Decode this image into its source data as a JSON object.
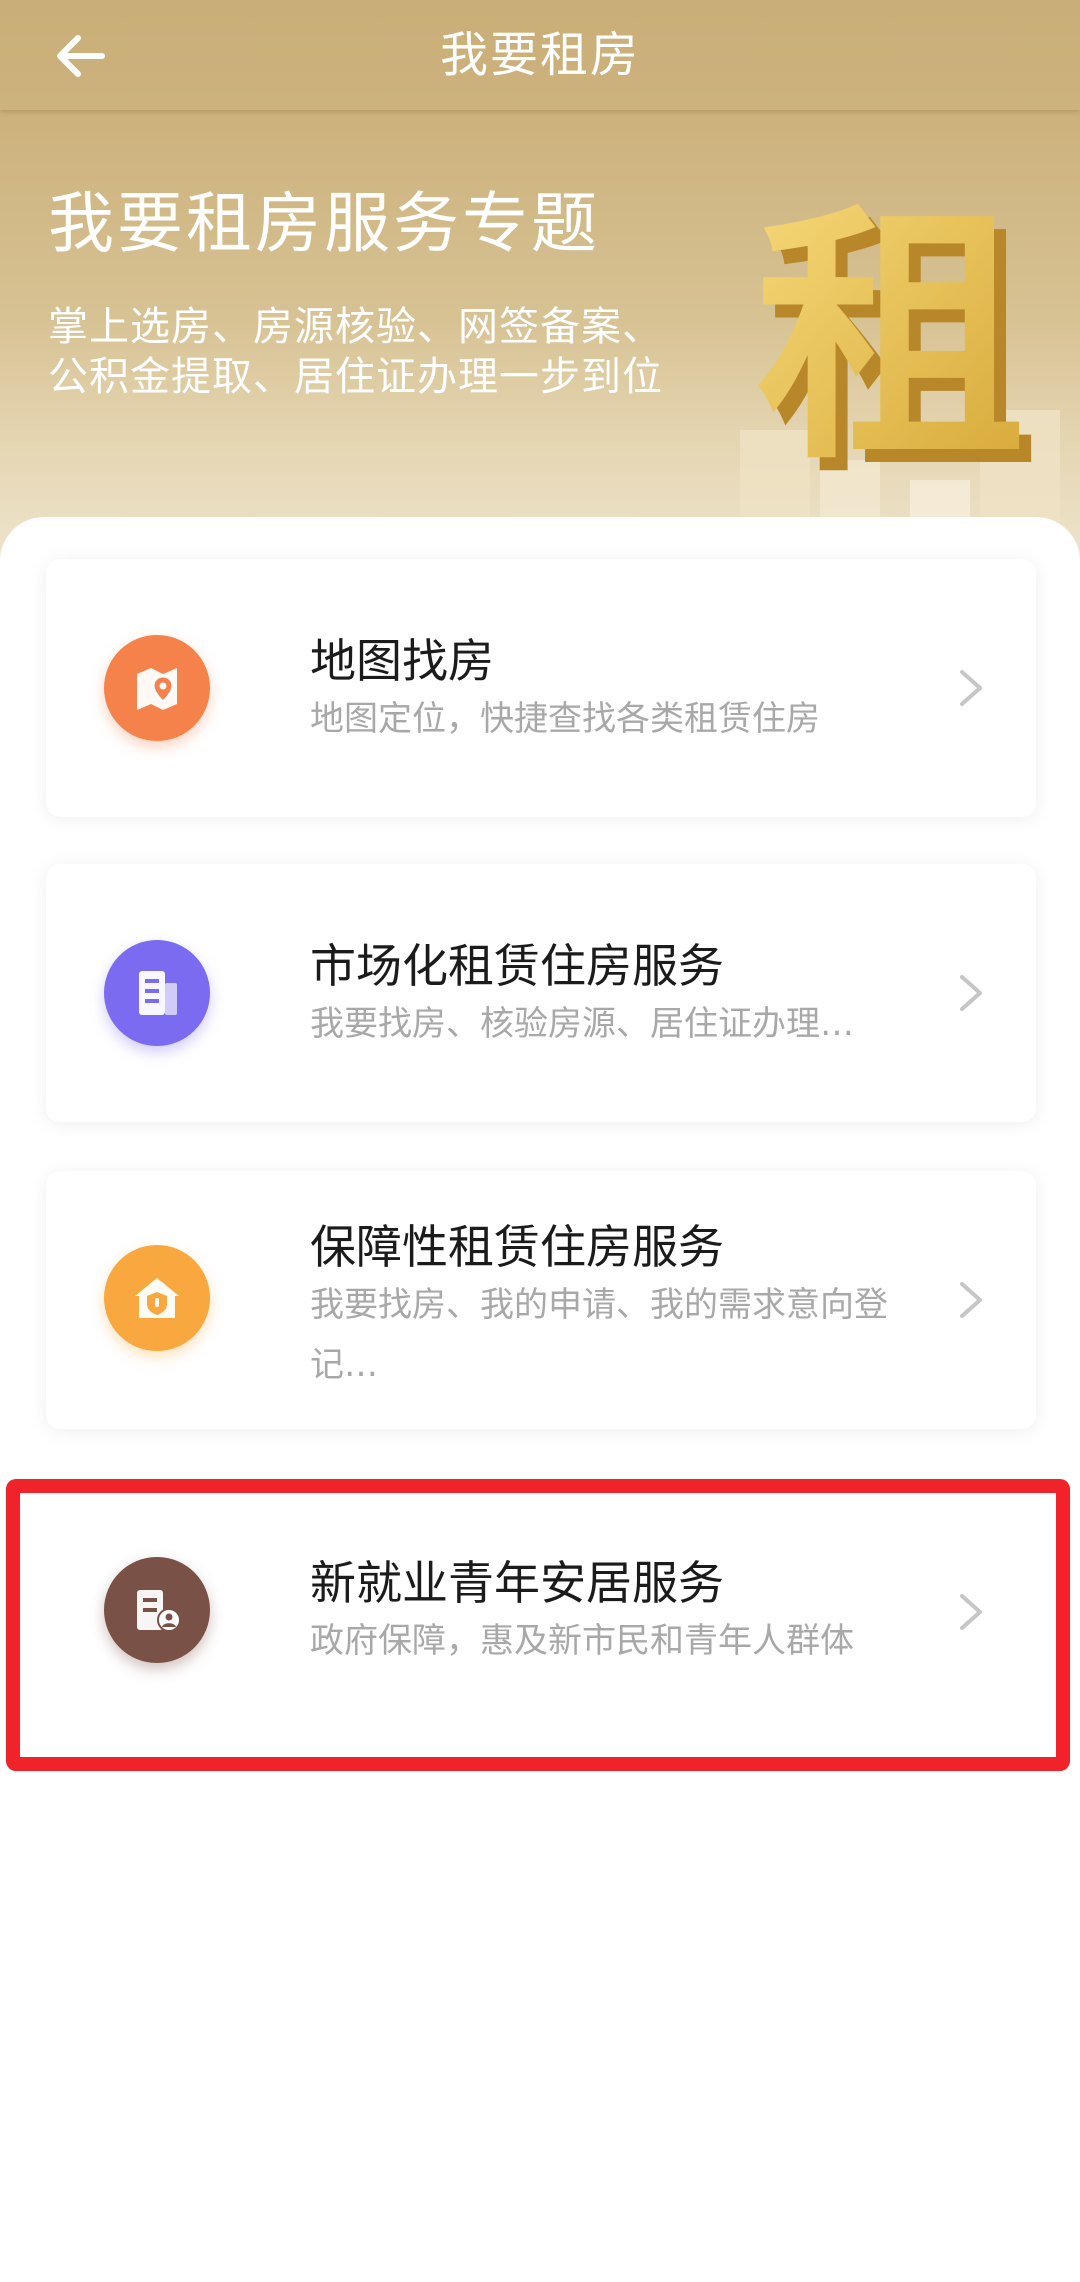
{
  "header": {
    "title": "我要租房",
    "back_icon": "arrow-left-icon"
  },
  "hero": {
    "title": "我要租房服务专题",
    "subtitle_line1": "掌上选房、房源核验、网签备案、",
    "subtitle_line2": "公积金提取、居住证办理一步到位",
    "art_glyph": "租"
  },
  "services": [
    {
      "title": "地图找房",
      "desc": "地图定位，快捷查找各类租赁住房",
      "icon": "map-pin-icon",
      "color": "#f5824a"
    },
    {
      "title": "市场化租赁住房服务",
      "desc": "我要找房、核验房源、居住证办理…",
      "icon": "building-icon",
      "color": "#7b6bf0"
    },
    {
      "title": "保障性租赁住房服务",
      "desc": "我要找房、我的申请、我的需求意向登记…",
      "icon": "house-shield-icon",
      "color": "#f8a83e"
    },
    {
      "title": "新就业青年安居服务",
      "desc": "政府保障，惠及新市民和青年人群体",
      "icon": "building-person-icon",
      "color": "#7a5146"
    }
  ],
  "colors": {
    "header_bg": "#c9ae78",
    "highlight": "#f0222a",
    "chevron": "#c6c6c6"
  }
}
